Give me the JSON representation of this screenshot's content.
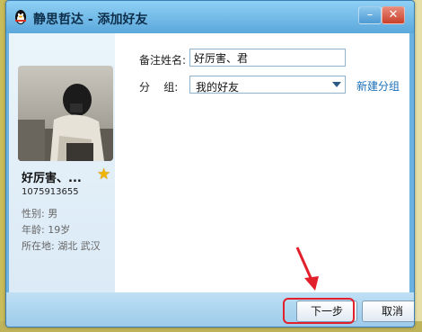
{
  "window": {
    "title": "静思哲达 - 添加好友"
  },
  "profile": {
    "nickname": "好厉害、...",
    "qq_number": "1075913655",
    "gender": "性别: 男",
    "age": "年龄: 19岁",
    "location": "所在地: 湖北  武汉"
  },
  "form": {
    "remark_label": "备注姓名:",
    "remark_value": "好厉害、君",
    "group_label": "分    组:",
    "group_value": "我的好友",
    "new_group_link": "新建分组"
  },
  "buttons": {
    "next": "下一步",
    "cancel": "取消"
  },
  "colors": {
    "title_bar": "#5ba8dc",
    "link": "#1a6fb8",
    "highlight": "#e2202b",
    "star": "#f0b400"
  },
  "icons": {
    "app": "qq-penguin-icon",
    "favorite": "star-icon"
  }
}
